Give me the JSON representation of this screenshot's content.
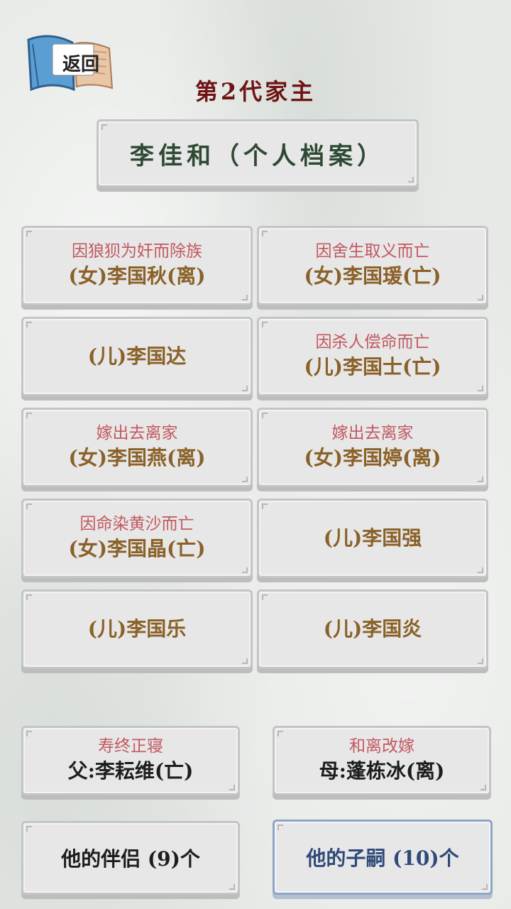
{
  "header": {
    "back_label": "返回",
    "generation_title": "第2代家主",
    "profile_title": "李佳和（个人档案）"
  },
  "children": [
    {
      "note": "因狼狈为奸而除族",
      "name": "(女)李国秋(离)"
    },
    {
      "note": "因舍生取义而亡",
      "name": "(女)李国瑗(亡)"
    },
    {
      "note": "",
      "name": "(儿)李国达"
    },
    {
      "note": "因杀人偿命而亡",
      "name": "(儿)李国士(亡)"
    },
    {
      "note": "嫁出去离家",
      "name": "(女)李国燕(离)"
    },
    {
      "note": "嫁出去离家",
      "name": "(女)李国婷(离)"
    },
    {
      "note": "因命染黄沙而亡",
      "name": "(女)李国晶(亡)"
    },
    {
      "note": "",
      "name": "(儿)李国强"
    },
    {
      "note": "",
      "name": "(儿)李国乐"
    },
    {
      "note": "",
      "name": "(儿)李国炎"
    }
  ],
  "parents": {
    "father": {
      "note": "寿终正寝",
      "name": "父:李耘维(亡)"
    },
    "mother": {
      "note": "和离改嫁",
      "name": "母:蓬栋冰(离)"
    }
  },
  "tabs": {
    "partners_label": "他的伴侣 (9)个",
    "children_label": "他的子嗣 (10)个"
  },
  "colors": {
    "title": "#6e1414",
    "profile": "#2f4a34",
    "note": "#c25860",
    "name": "#8a6128"
  }
}
